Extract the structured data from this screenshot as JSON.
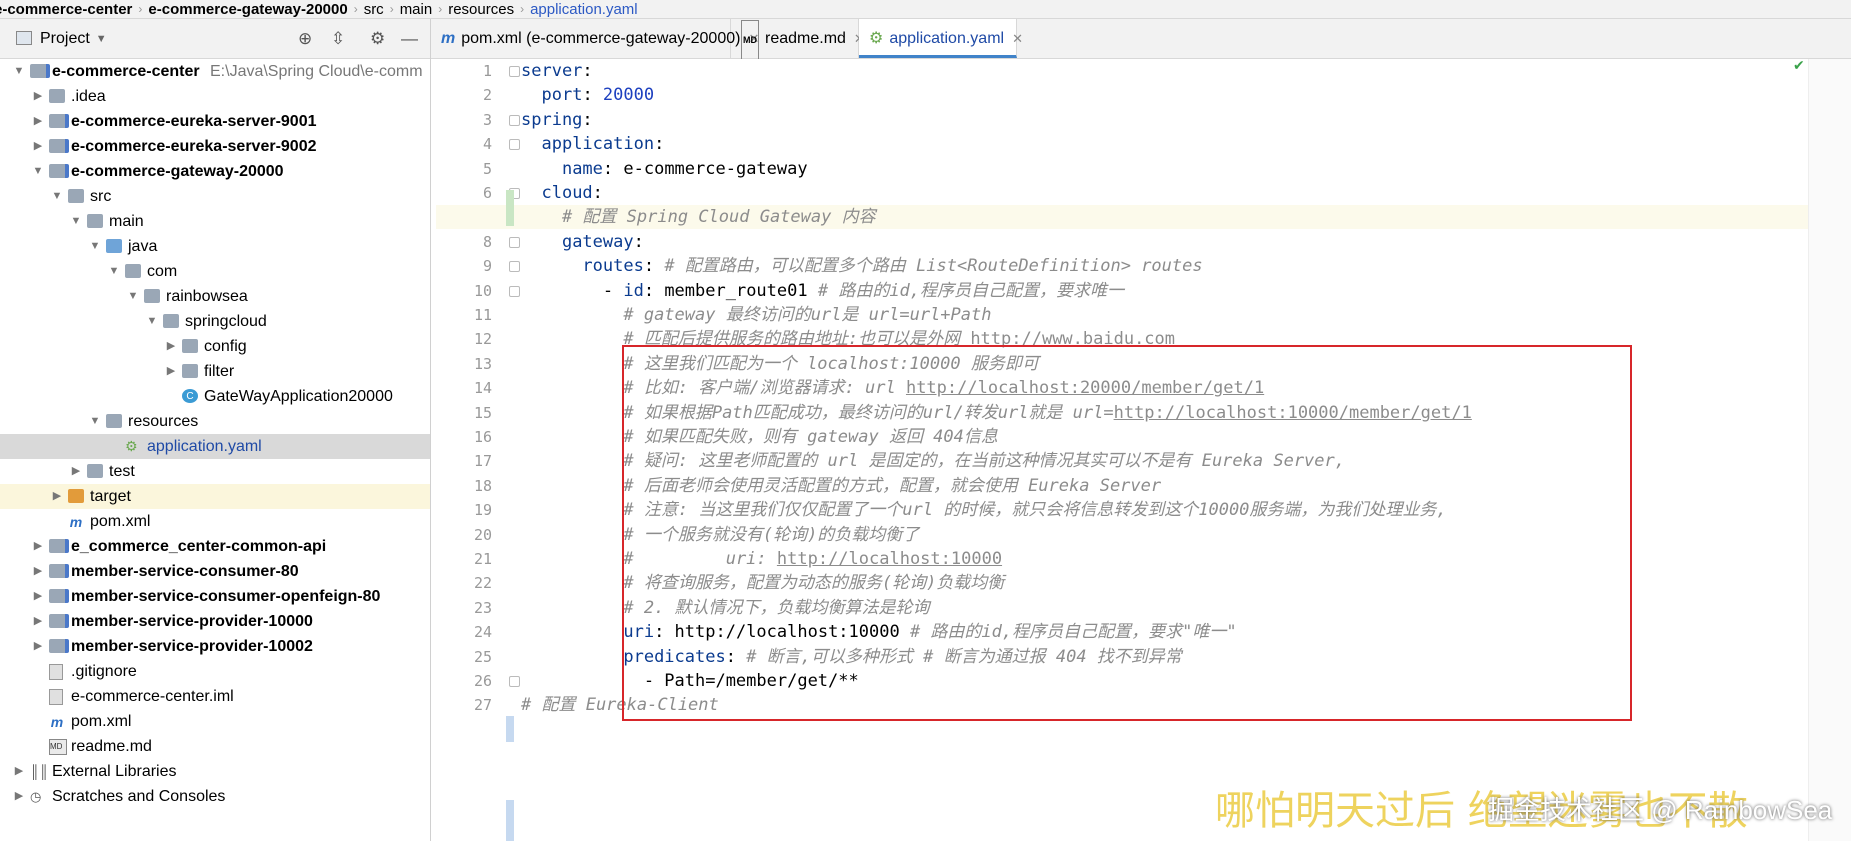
{
  "breadcrumb": [
    "e-commerce-center",
    "e-commerce-gateway-20000",
    "src",
    "main",
    "resources",
    "application.yaml"
  ],
  "project_panel": {
    "title": "Project",
    "icons": [
      "target-icon",
      "collapse-icon",
      "gear-icon",
      "minimize-icon"
    ]
  },
  "tree": [
    {
      "label": "e-commerce-center",
      "path": "E:\\Java\\Spring Cloud\\e-comm",
      "bold": true,
      "indent": 0,
      "arrow": "down",
      "icon": "module"
    },
    {
      "label": ".idea",
      "indent": 1,
      "arrow": "right",
      "icon": "folder"
    },
    {
      "label": "e-commerce-eureka-server-9001",
      "bold": true,
      "indent": 1,
      "arrow": "right",
      "icon": "module"
    },
    {
      "label": "e-commerce-eureka-server-9002",
      "bold": true,
      "indent": 1,
      "arrow": "right",
      "icon": "module"
    },
    {
      "label": "e-commerce-gateway-20000",
      "bold": true,
      "indent": 1,
      "arrow": "down",
      "icon": "module"
    },
    {
      "label": "src",
      "indent": 2,
      "arrow": "down",
      "icon": "folder"
    },
    {
      "label": "main",
      "indent": 3,
      "arrow": "down",
      "icon": "folder"
    },
    {
      "label": "java",
      "indent": 4,
      "arrow": "down",
      "icon": "folder-blue"
    },
    {
      "label": "com",
      "indent": 5,
      "arrow": "down",
      "icon": "folder"
    },
    {
      "label": "rainbowsea",
      "indent": 6,
      "arrow": "down",
      "icon": "folder"
    },
    {
      "label": "springcloud",
      "indent": 7,
      "arrow": "down",
      "icon": "folder"
    },
    {
      "label": "config",
      "indent": 8,
      "arrow": "right",
      "icon": "folder"
    },
    {
      "label": "filter",
      "indent": 8,
      "arrow": "right",
      "icon": "folder"
    },
    {
      "label": "GateWayApplication20000",
      "indent": 8,
      "arrow": "",
      "icon": "class"
    },
    {
      "label": "resources",
      "indent": 4,
      "arrow": "down",
      "icon": "folder"
    },
    {
      "label": "application.yaml",
      "indent": 5,
      "arrow": "",
      "icon": "yaml",
      "selected": true
    },
    {
      "label": "test",
      "indent": 3,
      "arrow": "right",
      "icon": "folder"
    },
    {
      "label": "target",
      "indent": 2,
      "arrow": "right",
      "icon": "folder-orange",
      "excluded": true
    },
    {
      "label": "pom.xml",
      "indent": 2,
      "arrow": "",
      "icon": "maven"
    },
    {
      "label": "e_commerce_center-common-api",
      "bold": true,
      "indent": 1,
      "arrow": "right",
      "icon": "module"
    },
    {
      "label": "member-service-consumer-80",
      "bold": true,
      "indent": 1,
      "arrow": "right",
      "icon": "module"
    },
    {
      "label": "member-service-consumer-openfeign-80",
      "bold": true,
      "indent": 1,
      "arrow": "right",
      "icon": "module"
    },
    {
      "label": "member-service-provider-10000",
      "bold": true,
      "indent": 1,
      "arrow": "right",
      "icon": "module"
    },
    {
      "label": "member-service-provider-10002",
      "bold": true,
      "indent": 1,
      "arrow": "right",
      "icon": "module"
    },
    {
      "label": ".gitignore",
      "indent": 1,
      "arrow": "",
      "icon": "file"
    },
    {
      "label": "e-commerce-center.iml",
      "indent": 1,
      "arrow": "",
      "icon": "file"
    },
    {
      "label": "pom.xml",
      "indent": 1,
      "arrow": "",
      "icon": "maven"
    },
    {
      "label": "readme.md",
      "indent": 1,
      "arrow": "",
      "icon": "md"
    },
    {
      "label": "External Libraries",
      "indent": 0,
      "arrow": "right",
      "icon": "library"
    },
    {
      "label": "Scratches and Consoles",
      "indent": 0,
      "arrow": "right",
      "icon": "scratch"
    }
  ],
  "tabs": [
    {
      "label": "pom.xml (e-commerce-gateway-20000)",
      "icon": "m",
      "active": false
    },
    {
      "label": "readme.md",
      "icon": "MD",
      "active": false
    },
    {
      "label": "application.yaml",
      "icon": "yaml",
      "active": true
    }
  ],
  "code": [
    [
      [
        "k",
        "server"
      ],
      [
        "t",
        ":"
      ]
    ],
    [
      [
        "t",
        "  "
      ],
      [
        "k",
        "port"
      ],
      [
        "t",
        ": "
      ],
      [
        "v",
        "20000"
      ]
    ],
    [
      [
        "k",
        "spring"
      ],
      [
        "t",
        ":"
      ]
    ],
    [
      [
        "t",
        "  "
      ],
      [
        "k",
        "application"
      ],
      [
        "t",
        ":"
      ]
    ],
    [
      [
        "t",
        "    "
      ],
      [
        "k",
        "name"
      ],
      [
        "t",
        ": e-commerce-gateway"
      ]
    ],
    [
      [
        "t",
        "  "
      ],
      [
        "k",
        "cloud"
      ],
      [
        "t",
        ":"
      ]
    ],
    [
      [
        "t",
        "    "
      ],
      [
        "c",
        "# 配置 Spring Cloud Gateway 内容"
      ]
    ],
    [
      [
        "t",
        "    "
      ],
      [
        "k",
        "gateway"
      ],
      [
        "t",
        ":"
      ]
    ],
    [
      [
        "t",
        "      "
      ],
      [
        "k",
        "routes"
      ],
      [
        "t",
        ": "
      ],
      [
        "c",
        "# 配置路由，可以配置多个路由 List<RouteDefinition> routes"
      ]
    ],
    [
      [
        "t",
        "        - "
      ],
      [
        "k",
        "id"
      ],
      [
        "t",
        ": member_route01 "
      ],
      [
        "c",
        "# 路由的id,程序员自己配置，要求唯一"
      ]
    ],
    [
      [
        "t",
        "          "
      ],
      [
        "c",
        "# gateway 最终访问的url是 url=url+Path"
      ]
    ],
    [
      [
        "t",
        "          "
      ],
      [
        "c",
        "# 匹配后提供服务的路由地址:也可以是外网 "
      ],
      [
        "u",
        "http://www.baidu.com"
      ]
    ],
    [
      [
        "t",
        "          "
      ],
      [
        "c",
        "# 这里我们匹配为一个 localhost:10000 服务即可"
      ]
    ],
    [
      [
        "t",
        "          "
      ],
      [
        "c",
        "# 比如: 客户端/浏览器请求: url "
      ],
      [
        "u",
        "http://localhost:20000/member/get/1"
      ]
    ],
    [
      [
        "t",
        "          "
      ],
      [
        "c",
        "# 如果根据Path匹配成功，最终访问的url/转发url就是 url="
      ],
      [
        "u",
        "http://localhost:10000/member/get/1"
      ]
    ],
    [
      [
        "t",
        "          "
      ],
      [
        "c",
        "# 如果匹配失败，则有 gateway 返回 404信息"
      ]
    ],
    [
      [
        "t",
        "          "
      ],
      [
        "c",
        "# 疑问: 这里老师配置的 url 是固定的，在当前这种情况其实可以不是有 Eureka Server,"
      ]
    ],
    [
      [
        "t",
        "          "
      ],
      [
        "c",
        "# 后面老师会使用灵活配置的方式，配置，就会使用 Eureka Server"
      ]
    ],
    [
      [
        "t",
        "          "
      ],
      [
        "c",
        "# 注意: 当这里我们仅仅配置了一个url 的时候，就只会将信息转发到这个10000服务端，为我们处理业务,"
      ]
    ],
    [
      [
        "t",
        "          "
      ],
      [
        "c",
        "# 一个服务就没有(轮询)的负载均衡了"
      ]
    ],
    [
      [
        "t",
        "          "
      ],
      [
        "c",
        "#         uri: "
      ],
      [
        "u",
        "http://localhost:10000"
      ]
    ],
    [
      [
        "t",
        "          "
      ],
      [
        "c",
        "# 将查询服务，配置为动态的服务(轮询)负载均衡"
      ]
    ],
    [
      [
        "t",
        "          "
      ],
      [
        "c",
        "# 2. 默认情况下，负载均衡算法是轮询"
      ]
    ],
    [
      [
        "t",
        "          "
      ],
      [
        "k",
        "uri"
      ],
      [
        "t",
        ": http://localhost:10000 "
      ],
      [
        "c",
        "# 路由的id,程序员自己配置，要求\"唯一\""
      ]
    ],
    [
      [
        "t",
        "          "
      ],
      [
        "k",
        "predicates"
      ],
      [
        "t",
        ": "
      ],
      [
        "c",
        "# 断言,可以多种形式 # 断言为通过报 404 找不到异常"
      ]
    ],
    [
      [
        "t",
        "            - Path=/member/get/**"
      ]
    ],
    [
      [
        "c",
        "# 配置 Eureka-Client"
      ]
    ]
  ],
  "watermark": "哪怕明天过后 绝望迷雾也不散",
  "watermark2": "掘金技术社区 @ RainbowSea"
}
